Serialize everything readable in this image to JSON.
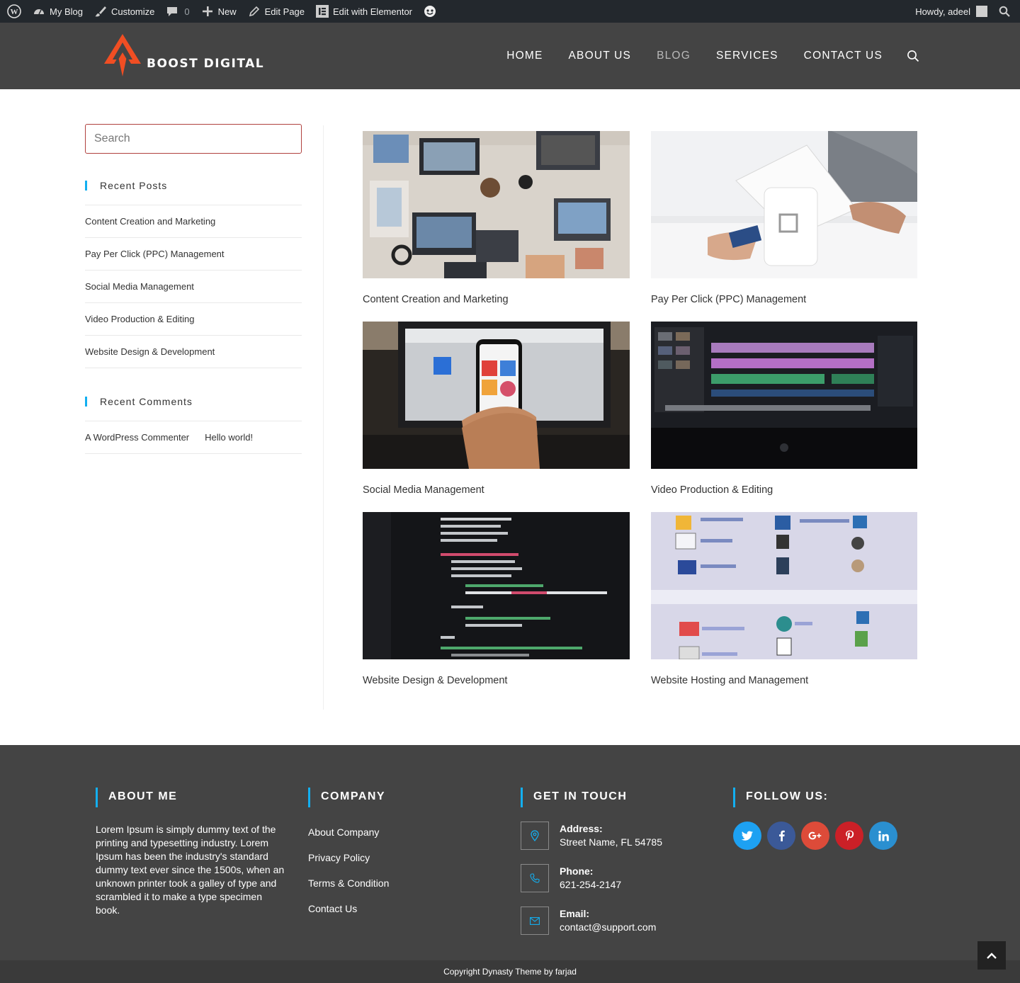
{
  "adminbar": {
    "site": "My Blog",
    "customize": "Customize",
    "comments_count": "0",
    "new": "New",
    "edit_page": "Edit Page",
    "elementor": "Edit with Elementor",
    "howdy": "Howdy, adeel"
  },
  "header": {
    "logo_text": "BOOST DIGITAL",
    "nav": [
      "HOME",
      "ABOUT US",
      "BLOG",
      "SERVICES",
      "CONTACT US"
    ],
    "active_nav": "BLOG",
    "brand_color": "#f04e23"
  },
  "sidebar": {
    "search_placeholder": "Search",
    "recent_posts_title": "Recent Posts",
    "recent_posts": [
      "Content Creation and Marketing",
      "Pay Per Click (PPC) Management",
      "Social Media Management",
      "Video Production & Editing",
      "Website Design & Development"
    ],
    "recent_comments_title": "Recent Comments",
    "comment_author": "A WordPress Commenter",
    "comment_post": "Hello world!"
  },
  "posts": [
    {
      "title": "Content Creation and Marketing",
      "image": "laptops-on-desk"
    },
    {
      "title": "Pay Per Click (PPC) Management",
      "image": "card-payment-terminal"
    },
    {
      "title": "Social Media Management",
      "image": "phone-over-laptop"
    },
    {
      "title": "Video Production & Editing",
      "image": "video-editing-screen"
    },
    {
      "title": "Website Design & Development",
      "image": "code-on-screen"
    },
    {
      "title": "Website Hosting and Management",
      "image": "hosting-control-panel"
    }
  ],
  "footer": {
    "about_title": "ABOUT ME",
    "about_text": "Lorem Ipsum is simply dummy text of the printing and typesetting industry. Lorem Ipsum has been the industry's standard dummy text ever since the 1500s, when an unknown printer took a galley of type and scrambled it to make a type specimen book.",
    "company_title": "COMPANY",
    "company_links": [
      "About Company",
      "Privacy Policy",
      "Terms & Condition",
      "Contact Us"
    ],
    "touch_title": "GET IN TOUCH",
    "address_label": "Address:",
    "address_value": "Street Name, FL 54785",
    "phone_label": "Phone:",
    "phone_value": "621-254-2147",
    "email_label": "Email:",
    "email_value": "contact@support.com",
    "follow_title": "FOLLOW US:",
    "socials": [
      {
        "name": "twitter-icon",
        "color": "#1da1f2"
      },
      {
        "name": "facebook-icon",
        "color": "#3b5998"
      },
      {
        "name": "google-plus-icon",
        "color": "#dd4b39"
      },
      {
        "name": "pinterest-icon",
        "color": "#cb2027"
      },
      {
        "name": "linkedin-icon",
        "color": "#2a8fd0"
      }
    ],
    "accent": "#13aff0",
    "copyright": "Copyright Dynasty Theme by farjad"
  }
}
